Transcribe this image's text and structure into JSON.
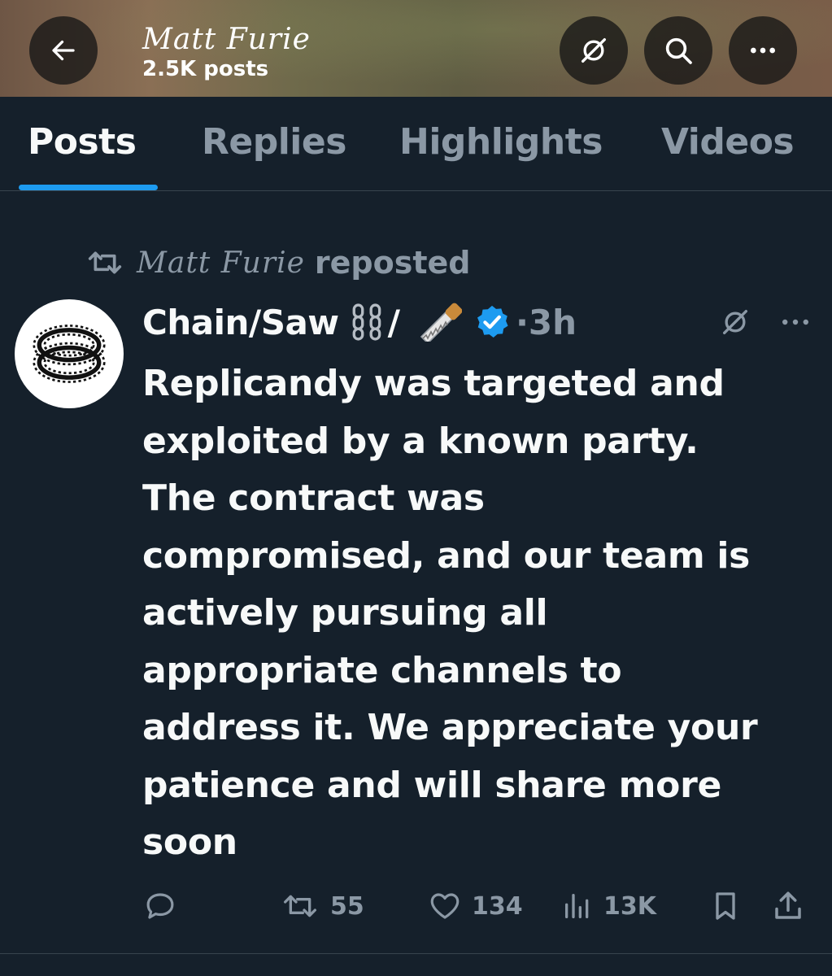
{
  "header": {
    "title": "Matt Furie",
    "post_count": "2.5K posts"
  },
  "tabs": [
    {
      "label": "Posts",
      "active": true
    },
    {
      "label": "Replies",
      "active": false
    },
    {
      "label": "Highlights",
      "active": false
    },
    {
      "label": "Videos",
      "active": false
    }
  ],
  "post": {
    "repost_by": "Matt Furie",
    "repost_suffix": "reposted",
    "author_name": "Chain/Saw",
    "author_slash": "/",
    "author_emojis": [
      "chains-emoji",
      "saw-emoji"
    ],
    "verified": true,
    "time": "·3h",
    "text": "Replicandy was targeted and\nexploited by a known party.\nThe contract was\ncompromised, and our team is\nactively pursuing all\nappropriate channels to\naddress it. We appreciate your\npatience and will share more\nsoon",
    "actions": {
      "reply_count": "",
      "repost_count": "55",
      "like_count": "134",
      "view_count": "13K"
    }
  },
  "colors": {
    "background": "#15202b",
    "accent": "#1d9bf0",
    "muted": "#8b98a5",
    "text": "#f7f9f9",
    "divider": "#38444d"
  }
}
